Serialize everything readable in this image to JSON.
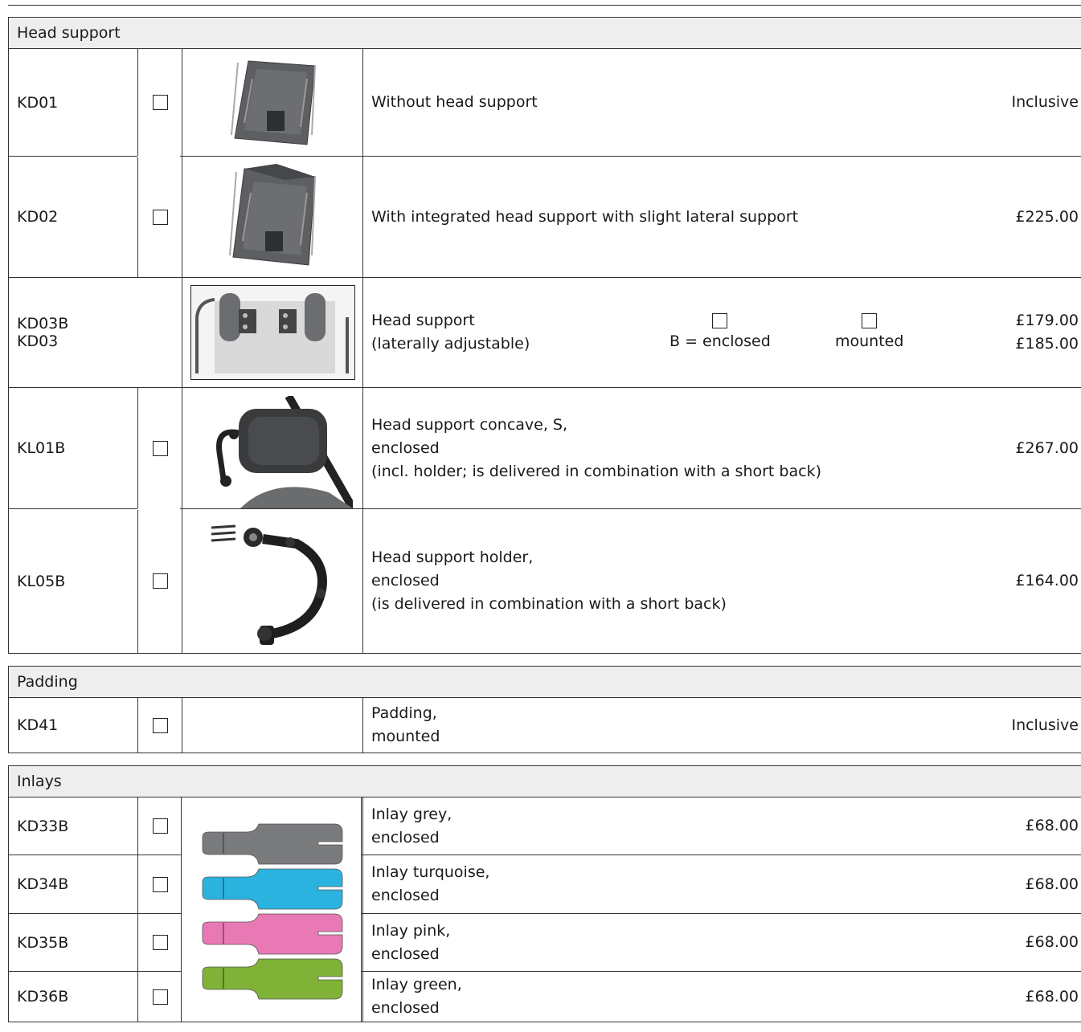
{
  "sections": {
    "head_support": {
      "title": "Head support",
      "rows": [
        {
          "code": "KD01",
          "desc": [
            "Without head support"
          ],
          "price": "Inclusive"
        },
        {
          "code": "KD02",
          "desc": [
            "With integrated head support with slight lateral support"
          ],
          "price": "£225.00"
        },
        {
          "codes": [
            "KD03B",
            "KD03"
          ],
          "desc": [
            "Head support",
            "(laterally adjustable)"
          ],
          "options": [
            "B = enclosed",
            "mounted"
          ],
          "prices": [
            "£179.00",
            "£185.00"
          ]
        },
        {
          "code": "KL01B",
          "desc": [
            "Head support concave, S,",
            "enclosed",
            "(incl. holder; is delivered in combination with a short back)"
          ],
          "price": "£267.00"
        },
        {
          "code": "KL05B",
          "desc": [
            "Head support holder,",
            "enclosed",
            "(is delivered in combination with a short back)"
          ],
          "price": "£164.00"
        }
      ]
    },
    "padding": {
      "title": "Padding",
      "rows": [
        {
          "code": "KD41",
          "desc": [
            "Padding,",
            "mounted"
          ],
          "price": "Inclusive"
        }
      ]
    },
    "inlays": {
      "title": "Inlays",
      "rows": [
        {
          "code": "KD33B",
          "desc": [
            "Inlay grey,",
            "enclosed"
          ],
          "price": "£68.00",
          "color": "#7a7b7d"
        },
        {
          "code": "KD34B",
          "desc": [
            "Inlay turquoise,",
            "enclosed"
          ],
          "price": "£68.00",
          "color": "#2bb3e0"
        },
        {
          "code": "KD35B",
          "desc": [
            "Inlay pink,",
            "enclosed"
          ],
          "price": "£68.00",
          "color": "#e879b5"
        },
        {
          "code": "KD36B",
          "desc": [
            "Inlay green,",
            "enclosed"
          ],
          "price": "£68.00",
          "color": "#7fb236"
        }
      ]
    }
  }
}
